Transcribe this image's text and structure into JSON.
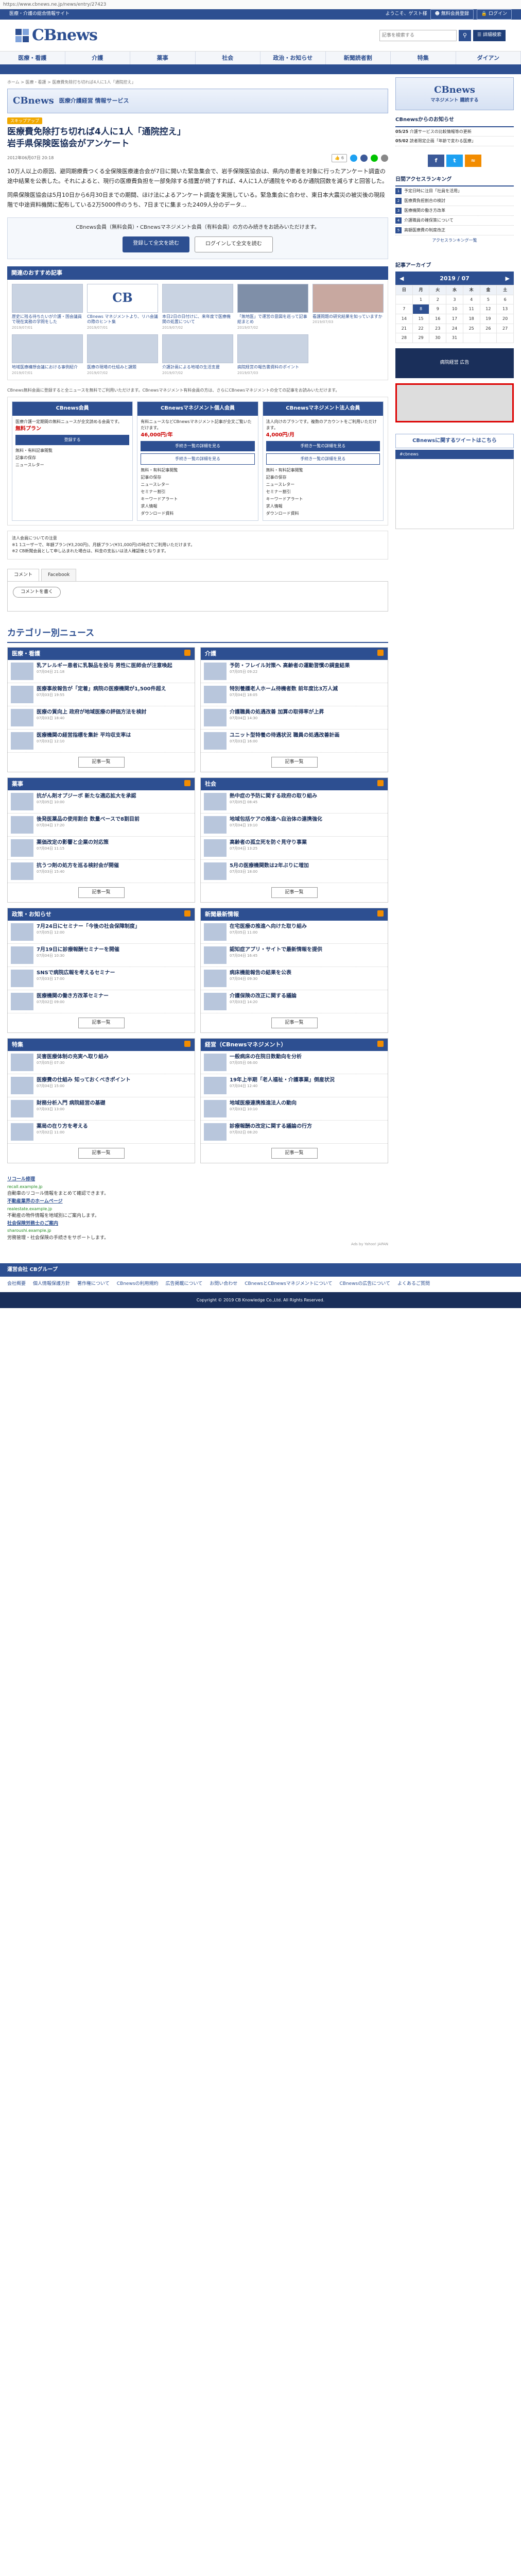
{
  "url": "https://www.cbnews.ne.jp/news/entry/27423",
  "topbar": {
    "tagline": "医療・介護の総合情報サイト",
    "welcome": "ようこそ、ゲスト様",
    "register": "無料会員登録",
    "login": "ログイン"
  },
  "site": {
    "name": "CBnews"
  },
  "search": {
    "placeholder": "記事を検索する",
    "detail": "詳細検索"
  },
  "gnav": [
    "医療・看護",
    "介護",
    "薬事",
    "社会",
    "政治・お知らせ",
    "新聞読者割",
    "特集",
    "ダイアン"
  ],
  "crumb": "ホーム > 医療・看護 > 医療費免除打ち切れば4人に1人「通院控え」",
  "banner": {
    "logo": "CBnews",
    "text": "医療介護経営 情報サービス"
  },
  "article": {
    "tag": "スキップアップ",
    "title_l1": "医療費免除打ち切れば4人に1人「通院控え」",
    "title_l2": "岩手県保険医協会がアンケート",
    "date": "2012年06月07日 20:18",
    "share": "6",
    "lead1": "10万人以上の原因、避同期療費つくる全保険医療連合会が7日に開いた緊急集会で、岩手保険医協会は、県内の患者を対象に行ったアンケート調査の途中結果を公表した。それによると、現行の医療費負担を一部免除する措置が終了すれば、4人に1人が通院をやめるか通院回数を減らすと回答した。",
    "lead2": "同県保険医協会は5月10日から6月30日までの期間、ほけ法によるアンケート調査を実施している。緊急集会に合わせ、東日本大震災の被災後の現段階で中途資料機関に配布している2万5000件のうち、7日までに集まった2409人分のデータ..."
  },
  "members": {
    "text": "CBnews会員（無料会員）・CBnewsマネジメント会員（有料会員）の方のみ続きをお読みいただけます。",
    "register": "登録して全文を読む",
    "login": "ログインして全文を読む"
  },
  "recommend": {
    "title": "関連のおすすめ記事",
    "items": [
      {
        "title": "歴史に残る待ちたいが介護・国会議員で現在実務の学問をした",
        "date": "2019/07/01"
      },
      {
        "title": "CBnews マネジメントより、リハ会議の際のヒント集",
        "date": "2019/07/01"
      },
      {
        "title": "本日2日の日付けに、来年度で医療機関の処置について",
        "date": "2019/07/02"
      },
      {
        "title": "「無地医」で運営の意図を巡って記事総まとめ",
        "date": "2019/07/02"
      },
      {
        "title": "看護問題の研究結果を知っていますか",
        "date": "2019/07/03"
      },
      {
        "title": "地域医療構想会議における事例紹介",
        "date": "2019/07/01"
      },
      {
        "title": "医療の現場の仕組みと課題",
        "date": "2019/07/02"
      },
      {
        "title": "介護計画による地域の生活支援",
        "date": "2019/07/02"
      },
      {
        "title": "病院経営の報告書資料のポイント",
        "date": "2019/07/03"
      }
    ]
  },
  "plans_note": "CBnews無料会員に登録すると全ニュースを無料でご利用いただけます。CBnewsマネジメント有料会員の方は、さらにCBnewsマネジメントの全ての記事をお読みいただけます。",
  "plans": [
    {
      "name": "CBnews会員",
      "desc": "医療介護一定期間の無料ニュースが全文読める会員です。",
      "price": "無料プラン",
      "btn": "登録する"
    },
    {
      "name": "CBnewsマネジメント個人会員",
      "desc": "有料ニュースなどCBnewsマネジメント記事が全文ご覧いただけます。",
      "price": "46,000円/年",
      "btn": "手続き一覧の詳細を見る"
    },
    {
      "name": "CBnewsマネジメント法人会員",
      "desc": "法人向けのプランです。複数のアカウントをご利用いただけます。",
      "price": "4,000円/月",
      "btn": "手続き一覧の詳細を見る"
    }
  ],
  "services": [
    "無料・有料記事閲覧",
    "記事の保存",
    "ニュースレター",
    "セミナー割引",
    "キーワードアラート",
    "求人情報",
    "ダウンロード資料"
  ],
  "footnote": "法人会員についての注意\n※1 1ユーザーで、年額プラン(¥3,200円)、月額プラン(¥31,000円)の時点でご利用いただけます。\n※2 CB新聞会員として申し込まれた場合は、料金の支払いは法人確認後となります。",
  "comments": {
    "tab1": "コメント",
    "tab2": "Facebook",
    "write": "コメントを書く"
  },
  "categories": {
    "title": "カテゴリー別ニュース",
    "more": "記事一覧",
    "boxes": [
      {
        "name": "医療・看護",
        "items": [
          {
            "t": "乳アレルギー患者に乳製品を投与 男性に医師会が注意喚起",
            "d": "07月04日 21:18"
          },
          {
            "t": "医療事故報告が「定着」病院の医療機関が1,500件超え",
            "d": "07月03日 19:55"
          },
          {
            "t": "医療の質向上 政府が地域医療の評価方法を検討",
            "d": "07月03日 18:40"
          },
          {
            "t": "医療機関の経営指標を集計 平均収支率は",
            "d": "07月03日 12:10"
          }
        ]
      },
      {
        "name": "介護",
        "items": [
          {
            "t": "予防・フレイル対策へ 高齢者の運動習慣の調査結果",
            "d": "07月05日 09:22"
          },
          {
            "t": "特別養護老人ホーム待機者数 前年度比3万人減",
            "d": "07月04日 18:05"
          },
          {
            "t": "介護職員の処遇改善 加算の取得率が上昇",
            "d": "07月04日 14:30"
          },
          {
            "t": "ユニット型特養の待遇状況 職員の処遇改善計画",
            "d": "07月03日 16:00"
          }
        ]
      },
      {
        "name": "薬事",
        "items": [
          {
            "t": "抗がん剤オプジーボ 新たな適応拡大を承認",
            "d": "07月05日 10:00"
          },
          {
            "t": "後発医薬品の使用割合 数量ベースで8割目前",
            "d": "07月04日 17:20"
          },
          {
            "t": "薬価改定の影響と企業の対応策",
            "d": "07月04日 11:15"
          },
          {
            "t": "抗うつ剤の処方を巡る検討会が開催",
            "d": "07月03日 15:40"
          }
        ]
      },
      {
        "name": "社会",
        "items": [
          {
            "t": "熱中症の予防に関する政府の取り組み",
            "d": "07月05日 08:45"
          },
          {
            "t": "地域包括ケアの推進へ自治体の連携強化",
            "d": "07月04日 19:10"
          },
          {
            "t": "高齢者の孤立死を防ぐ見守り事業",
            "d": "07月04日 13:25"
          },
          {
            "t": "5月の医療機関数は2年ぶりに増加",
            "d": "07月03日 18:00"
          }
        ]
      },
      {
        "name": "政策・お知らせ",
        "items": [
          {
            "t": "7月24日にセミナー「今後の社会保障制度」",
            "d": "07月05日 12:00"
          },
          {
            "t": "7月19日に診療報酬セミナーを開催",
            "d": "07月04日 10:30"
          },
          {
            "t": "SNSで病院広報を考えるセミナー",
            "d": "07月03日 17:00"
          },
          {
            "t": "医療機関の働き方改革セミナー",
            "d": "07月02日 09:00"
          }
        ]
      },
      {
        "name": "新聞最新情報",
        "items": [
          {
            "t": "在宅医療の推進へ向けた取り組み",
            "d": "07月05日 11:00"
          },
          {
            "t": "認知症アプリ・サイトで最新情報を提供",
            "d": "07月04日 16:45"
          },
          {
            "t": "病床機能報告の結果を公表",
            "d": "07月04日 09:30"
          },
          {
            "t": "介護保険の改正に関する議論",
            "d": "07月03日 14:20"
          }
        ]
      },
      {
        "name": "特集",
        "items": [
          {
            "t": "災害医療体制の充実へ取り組み",
            "d": "07月05日 07:30"
          },
          {
            "t": "医療費の仕組み 知っておくべきポイント",
            "d": "07月04日 15:00"
          },
          {
            "t": "財務分析入門 病院経営の基礎",
            "d": "07月03日 13:00"
          },
          {
            "t": "薬局の在り方を考える",
            "d": "07月02日 11:00"
          }
        ]
      },
      {
        "name": "経営（CBnewsマネジメント）",
        "items": [
          {
            "t": "一般病床の在院日数動向を分析",
            "d": "07月05日 06:00"
          },
          {
            "t": "19年上半期「老人福祉・介護事業」倒産状況",
            "d": "07月04日 12:40"
          },
          {
            "t": "地域医療連携推進法人の動向",
            "d": "07月03日 10:10"
          },
          {
            "t": "診療報酬の改定に関する議論の行方",
            "d": "07月02日 08:20"
          }
        ]
      }
    ]
  },
  "adlinks": [
    {
      "h": "リコール修理",
      "u": "recall.example.jp",
      "t": "自動車のリコール情報をまとめて確認できます。"
    },
    {
      "h": "不動産業界のホームページ",
      "u": "realestate.example.jp",
      "t": "不動産の物件情報を地域別にご案内します。"
    },
    {
      "h": "社会保険労務士のご案内",
      "u": "sharoushi.example.jp",
      "t": "労務管理・社会保険の手続きをサポートします。"
    }
  ],
  "ads_by": "Ads by Yahoo! JAPAN",
  "side": {
    "banner_logo": "CBnews",
    "banner_text": "マネジメント 購読する",
    "notice_title": "CBnewsからのお知らせ",
    "notices": [
      {
        "d": "05/25",
        "t": "介護サービスの比較情報等の更新"
      },
      {
        "d": "05/02",
        "t": "読者限定企画「年齢で変わる医療」"
      }
    ],
    "ranking_title": "日間アクセスランキング",
    "ranking": [
      "予定日時に注目「社員を活用」",
      "医療費負担割合の検討",
      "医療機関の働き方改革",
      "介護職員の確保策について",
      "高額医療費の制度改正"
    ],
    "ranking_more": "アクセスランキング一覧",
    "archive_title": "記事アーカイブ",
    "month": "2019 / 07",
    "weekdays": [
      "日",
      "月",
      "火",
      "水",
      "木",
      "金",
      "土"
    ],
    "days": [
      [
        "",
        "1",
        "2",
        "3",
        "4",
        "5",
        "6"
      ],
      [
        "7",
        "8",
        "9",
        "10",
        "11",
        "12",
        "13"
      ],
      [
        "14",
        "15",
        "16",
        "17",
        "18",
        "19",
        "20"
      ],
      [
        "21",
        "22",
        "23",
        "24",
        "25",
        "26",
        "27"
      ],
      [
        "28",
        "29",
        "30",
        "31",
        "",
        "",
        ""
      ]
    ],
    "ad": "病院経営 広告",
    "twitter_btn": "CBnewsに関するツイートはこちら",
    "twitter_bar": "#cbnews"
  },
  "footer": {
    "company": "運営会社 CBグループ",
    "links": [
      "会社概要",
      "個人情報保護方針",
      "著作権について",
      "CBnewsの利用規約",
      "広告掲載について",
      "お問い合わせ",
      "CBnewsとCBnewsマネジメントについて",
      "CBnewsの広告について",
      "よくあるご質問"
    ],
    "copy": "Copyright © 2019 CB Knowledge Co.,Ltd. All Rights Reserved."
  }
}
